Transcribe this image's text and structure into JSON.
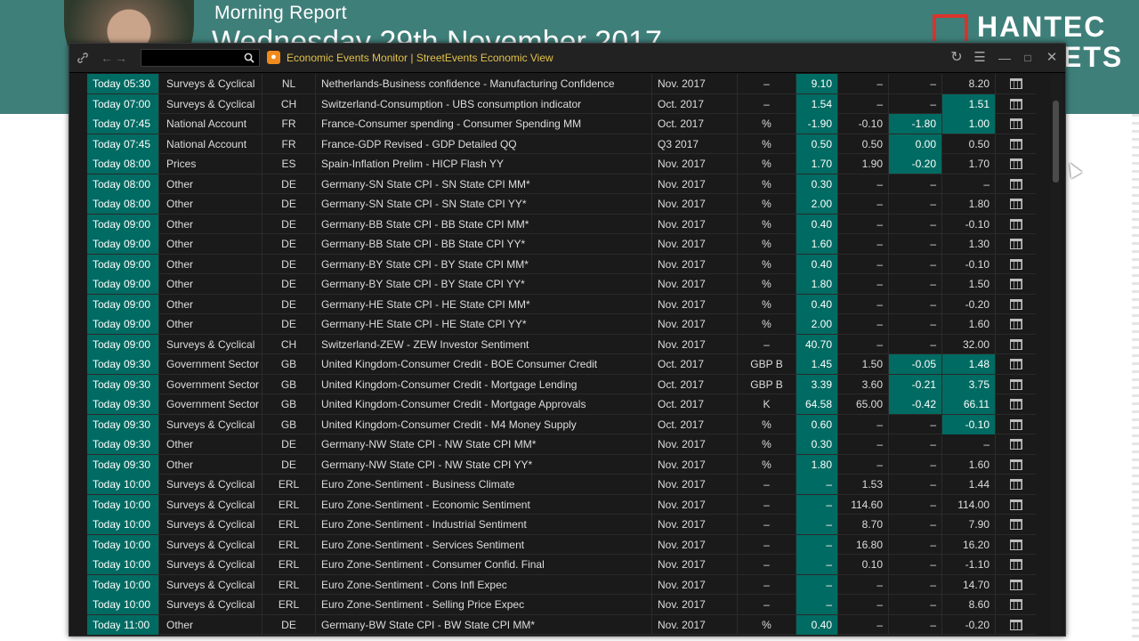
{
  "slide": {
    "title": "Morning Report",
    "subtitle": "Wednesday 29th November 2017",
    "brand_line1": "HANTEC",
    "brand_line2": "ETS"
  },
  "window": {
    "title": "Economic Events Monitor | StreetEvents Economic View",
    "search_placeholder": "",
    "icons": [
      "link-icon",
      "back-arrow-icon",
      "forward-arrow-icon",
      "search-icon",
      "refresh-icon",
      "menu-icon",
      "minimize-icon",
      "maximize-icon",
      "close-icon"
    ],
    "accent_color": "#006b62",
    "title_color": "#e2c24a"
  },
  "rows": [
    {
      "day": "Today",
      "time": "05:30",
      "category": "Surveys & Cyclical",
      "country": "NL",
      "event": "Netherlands-Business confidence - Manufacturing Confidence",
      "period": "Nov. 2017",
      "unit": "–",
      "actual": "9.10",
      "consensus": "–",
      "surprise": "–",
      "prior": "8.20",
      "s_hl": false,
      "p_hl": false
    },
    {
      "day": "Today",
      "time": "07:00",
      "category": "Surveys & Cyclical",
      "country": "CH",
      "event": "Switzerland-Consumption - UBS consumption indicator",
      "period": "Oct. 2017",
      "unit": "–",
      "actual": "1.54",
      "consensus": "–",
      "surprise": "–",
      "prior": "1.51",
      "s_hl": false,
      "p_hl": true
    },
    {
      "day": "Today",
      "time": "07:45",
      "category": "National Account",
      "country": "FR",
      "event": "France-Consumer spending - Consumer Spending MM",
      "period": "Oct. 2017",
      "unit": "%",
      "actual": "-1.90",
      "consensus": "-0.10",
      "surprise": "-1.80",
      "prior": "1.00",
      "s_hl": true,
      "p_hl": true
    },
    {
      "day": "Today",
      "time": "07:45",
      "category": "National Account",
      "country": "FR",
      "event": "France-GDP Revised - GDP Detailed QQ",
      "period": "Q3 2017",
      "unit": "%",
      "actual": "0.50",
      "consensus": "0.50",
      "surprise": "0.00",
      "prior": "0.50",
      "s_hl": true,
      "p_hl": false
    },
    {
      "day": "Today",
      "time": "08:00",
      "category": "Prices",
      "country": "ES",
      "event": "Spain-Inflation Prelim - HICP Flash YY",
      "period": "Nov. 2017",
      "unit": "%",
      "actual": "1.70",
      "consensus": "1.90",
      "surprise": "-0.20",
      "prior": "1.70",
      "s_hl": true,
      "p_hl": false
    },
    {
      "day": "Today",
      "time": "08:00",
      "category": "Other",
      "country": "DE",
      "event": "Germany-SN State CPI - SN State CPI MM*",
      "period": "Nov. 2017",
      "unit": "%",
      "actual": "0.30",
      "consensus": "–",
      "surprise": "–",
      "prior": "–",
      "s_hl": false,
      "p_hl": false
    },
    {
      "day": "Today",
      "time": "08:00",
      "category": "Other",
      "country": "DE",
      "event": "Germany-SN State CPI - SN State CPI YY*",
      "period": "Nov. 2017",
      "unit": "%",
      "actual": "2.00",
      "consensus": "–",
      "surprise": "–",
      "prior": "1.80",
      "s_hl": false,
      "p_hl": false
    },
    {
      "day": "Today",
      "time": "09:00",
      "category": "Other",
      "country": "DE",
      "event": "Germany-BB State CPI - BB State CPI MM*",
      "period": "Nov. 2017",
      "unit": "%",
      "actual": "0.40",
      "consensus": "–",
      "surprise": "–",
      "prior": "-0.10",
      "s_hl": false,
      "p_hl": false
    },
    {
      "day": "Today",
      "time": "09:00",
      "category": "Other",
      "country": "DE",
      "event": "Germany-BB State CPI - BB State CPI YY*",
      "period": "Nov. 2017",
      "unit": "%",
      "actual": "1.60",
      "consensus": "–",
      "surprise": "–",
      "prior": "1.30",
      "s_hl": false,
      "p_hl": false
    },
    {
      "day": "Today",
      "time": "09:00",
      "category": "Other",
      "country": "DE",
      "event": "Germany-BY State CPI - BY State CPI MM*",
      "period": "Nov. 2017",
      "unit": "%",
      "actual": "0.40",
      "consensus": "–",
      "surprise": "–",
      "prior": "-0.10",
      "s_hl": false,
      "p_hl": false
    },
    {
      "day": "Today",
      "time": "09:00",
      "category": "Other",
      "country": "DE",
      "event": "Germany-BY State CPI - BY State CPI YY*",
      "period": "Nov. 2017",
      "unit": "%",
      "actual": "1.80",
      "consensus": "–",
      "surprise": "–",
      "prior": "1.50",
      "s_hl": false,
      "p_hl": false
    },
    {
      "day": "Today",
      "time": "09:00",
      "category": "Other",
      "country": "DE",
      "event": "Germany-HE State CPI - HE State CPI MM*",
      "period": "Nov. 2017",
      "unit": "%",
      "actual": "0.40",
      "consensus": "–",
      "surprise": "–",
      "prior": "-0.20",
      "s_hl": false,
      "p_hl": false
    },
    {
      "day": "Today",
      "time": "09:00",
      "category": "Other",
      "country": "DE",
      "event": "Germany-HE State CPI - HE State CPI YY*",
      "period": "Nov. 2017",
      "unit": "%",
      "actual": "2.00",
      "consensus": "–",
      "surprise": "–",
      "prior": "1.60",
      "s_hl": false,
      "p_hl": false
    },
    {
      "day": "Today",
      "time": "09:00",
      "category": "Surveys & Cyclical",
      "country": "CH",
      "event": "Switzerland-ZEW - ZEW Investor Sentiment",
      "period": "Nov. 2017",
      "unit": "–",
      "actual": "40.70",
      "consensus": "–",
      "surprise": "–",
      "prior": "32.00",
      "s_hl": false,
      "p_hl": false
    },
    {
      "day": "Today",
      "time": "09:30",
      "category": "Government Sector",
      "country": "GB",
      "event": "United Kingdom-Consumer Credit - BOE Consumer Credit",
      "period": "Oct. 2017",
      "unit": "GBP B",
      "actual": "1.45",
      "consensus": "1.50",
      "surprise": "-0.05",
      "prior": "1.48",
      "s_hl": true,
      "p_hl": true
    },
    {
      "day": "Today",
      "time": "09:30",
      "category": "Government Sector",
      "country": "GB",
      "event": "United Kingdom-Consumer Credit - Mortgage Lending",
      "period": "Oct. 2017",
      "unit": "GBP B",
      "actual": "3.39",
      "consensus": "3.60",
      "surprise": "-0.21",
      "prior": "3.75",
      "s_hl": true,
      "p_hl": true
    },
    {
      "day": "Today",
      "time": "09:30",
      "category": "Government Sector",
      "country": "GB",
      "event": "United Kingdom-Consumer Credit - Mortgage Approvals",
      "period": "Oct. 2017",
      "unit": "K",
      "actual": "64.58",
      "consensus": "65.00",
      "surprise": "-0.42",
      "prior": "66.11",
      "s_hl": true,
      "p_hl": true
    },
    {
      "day": "Today",
      "time": "09:30",
      "category": "Surveys & Cyclical",
      "country": "GB",
      "event": "United Kingdom-Consumer Credit - M4 Money Supply",
      "period": "Oct. 2017",
      "unit": "%",
      "actual": "0.60",
      "consensus": "–",
      "surprise": "–",
      "prior": "-0.10",
      "s_hl": false,
      "p_hl": true
    },
    {
      "day": "Today",
      "time": "09:30",
      "category": "Other",
      "country": "DE",
      "event": "Germany-NW State CPI - NW State CPI MM*",
      "period": "Nov. 2017",
      "unit": "%",
      "actual": "0.30",
      "consensus": "–",
      "surprise": "–",
      "prior": "–",
      "s_hl": false,
      "p_hl": false
    },
    {
      "day": "Today",
      "time": "09:30",
      "category": "Other",
      "country": "DE",
      "event": "Germany-NW State CPI - NW State CPI YY*",
      "period": "Nov. 2017",
      "unit": "%",
      "actual": "1.80",
      "consensus": "–",
      "surprise": "–",
      "prior": "1.60",
      "s_hl": false,
      "p_hl": false
    },
    {
      "day": "Today",
      "time": "10:00",
      "category": "Surveys & Cyclical",
      "country": "ERL",
      "event": "Euro Zone-Sentiment - Business Climate",
      "period": "Nov. 2017",
      "unit": "–",
      "actual": "–",
      "consensus": "1.53",
      "surprise": "–",
      "prior": "1.44",
      "s_hl": false,
      "p_hl": false
    },
    {
      "day": "Today",
      "time": "10:00",
      "category": "Surveys & Cyclical",
      "country": "ERL",
      "event": "Euro Zone-Sentiment - Economic Sentiment",
      "period": "Nov. 2017",
      "unit": "–",
      "actual": "–",
      "consensus": "114.60",
      "surprise": "–",
      "prior": "114.00",
      "s_hl": false,
      "p_hl": false
    },
    {
      "day": "Today",
      "time": "10:00",
      "category": "Surveys & Cyclical",
      "country": "ERL",
      "event": "Euro Zone-Sentiment - Industrial Sentiment",
      "period": "Nov. 2017",
      "unit": "–",
      "actual": "–",
      "consensus": "8.70",
      "surprise": "–",
      "prior": "7.90",
      "s_hl": false,
      "p_hl": false
    },
    {
      "day": "Today",
      "time": "10:00",
      "category": "Surveys & Cyclical",
      "country": "ERL",
      "event": "Euro Zone-Sentiment - Services Sentiment",
      "period": "Nov. 2017",
      "unit": "–",
      "actual": "–",
      "consensus": "16.80",
      "surprise": "–",
      "prior": "16.20",
      "s_hl": false,
      "p_hl": false
    },
    {
      "day": "Today",
      "time": "10:00",
      "category": "Surveys & Cyclical",
      "country": "ERL",
      "event": "Euro Zone-Sentiment - Consumer Confid. Final",
      "period": "Nov. 2017",
      "unit": "–",
      "actual": "–",
      "consensus": "0.10",
      "surprise": "–",
      "prior": "-1.10",
      "s_hl": false,
      "p_hl": false
    },
    {
      "day": "Today",
      "time": "10:00",
      "category": "Surveys & Cyclical",
      "country": "ERL",
      "event": "Euro Zone-Sentiment - Cons Infl Expec",
      "period": "Nov. 2017",
      "unit": "–",
      "actual": "–",
      "consensus": "–",
      "surprise": "–",
      "prior": "14.70",
      "s_hl": false,
      "p_hl": false
    },
    {
      "day": "Today",
      "time": "10:00",
      "category": "Surveys & Cyclical",
      "country": "ERL",
      "event": "Euro Zone-Sentiment - Selling Price Expec",
      "period": "Nov. 2017",
      "unit": "–",
      "actual": "–",
      "consensus": "–",
      "surprise": "–",
      "prior": "8.60",
      "s_hl": false,
      "p_hl": false
    },
    {
      "day": "Today",
      "time": "11:00",
      "category": "Other",
      "country": "DE",
      "event": "Germany-BW State CPI - BW State CPI MM*",
      "period": "Nov. 2017",
      "unit": "%",
      "actual": "0.40",
      "consensus": "–",
      "surprise": "–",
      "prior": "-0.20",
      "s_hl": false,
      "p_hl": false
    }
  ]
}
